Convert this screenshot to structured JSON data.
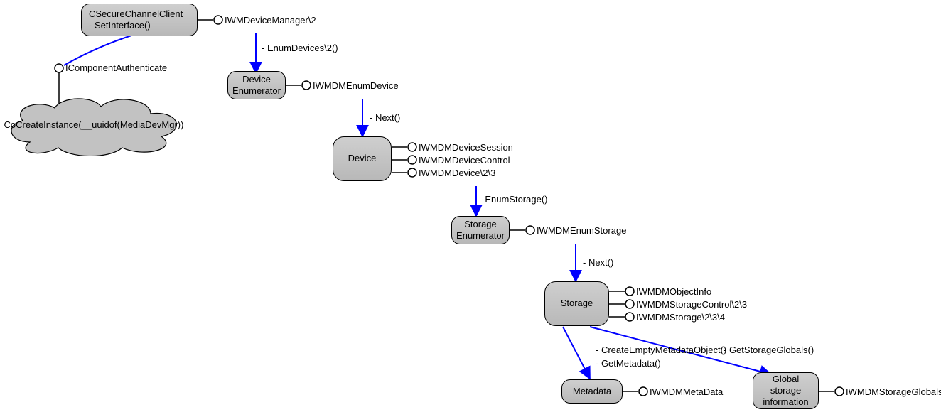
{
  "nodes": {
    "secureClient": "CSecureChannelClient\n- SetInterface()",
    "deviceEnum": "Device\nEnumerator",
    "device": "Device",
    "storageEnum": "Storage\nEnumerator",
    "storage": "Storage",
    "metadata": "Metadata",
    "globalStorage": "Global\nstorage\ninformation",
    "cloud": "CoCreateInstance(__uuidof(MediaDevMgr))"
  },
  "interfaces": {
    "iwmDeviceManager": "IWMDeviceManager\\2",
    "iComponentAuth": "IComponentAuthenticate",
    "iwmdmEnumDevice": "IWMDMEnumDevice",
    "iwmdmDeviceSession": "IWMDMDeviceSession",
    "iwmdmDeviceControl": "IWMDMDeviceControl",
    "iwmdmDevice": "IWMDMDevice\\2\\3",
    "iwmdmEnumStorage": "IWMDMEnumStorage",
    "iwmdmObjectInfo": "IWMDMObjectInfo",
    "iwmdmStorageControl": "IWMDMStorageControl\\2\\3",
    "iwmdmStorage": "IWMDMStorage\\2\\3\\4",
    "iwmdmMetaData": "IWMDMMetaData",
    "iwmdmStorageGlobals": "IWMDMStorageGlobals"
  },
  "edges": {
    "enumDevices": "- EnumDevices\\2()",
    "next1": "- Next()",
    "enumStorage": "-EnumStorage()",
    "next2": "- Next()",
    "createEmpty": "- CreateEmptyMetadataObject()",
    "getMetadata": "- GetMetadata()",
    "getStorageGlobals": "- GetStorageGlobals()"
  }
}
